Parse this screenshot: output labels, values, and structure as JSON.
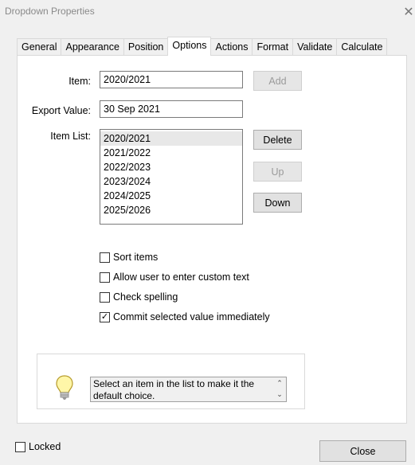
{
  "window": {
    "title": "Dropdown Properties"
  },
  "tabs": [
    {
      "label": "General"
    },
    {
      "label": "Appearance"
    },
    {
      "label": "Position"
    },
    {
      "label": "Options",
      "active": true
    },
    {
      "label": "Actions"
    },
    {
      "label": "Format"
    },
    {
      "label": "Validate"
    },
    {
      "label": "Calculate"
    }
  ],
  "options": {
    "item_label": "Item:",
    "item_value": "2020/2021",
    "export_label": "Export Value:",
    "export_value": "30 Sep 2021",
    "add_label": "Add",
    "item_list_label": "Item List:",
    "item_list": [
      "2020/2021",
      "2021/2022",
      "2022/2023",
      "2023/2024",
      "2024/2025",
      "2025/2026"
    ],
    "delete_label": "Delete",
    "up_label": "Up",
    "down_label": "Down",
    "checkboxes": [
      {
        "label": "Sort items",
        "checked": false
      },
      {
        "label": "Allow user to enter custom text",
        "checked": false
      },
      {
        "label": "Check spelling",
        "checked": false
      },
      {
        "label": "Commit selected value immediately",
        "checked": true
      }
    ],
    "hint": "Select an item in the list to make it the default choice."
  },
  "footer": {
    "locked_label": "Locked",
    "locked_checked": false,
    "close_label": "Close"
  },
  "icons": {
    "check_glyph": "✓",
    "close_glyph": "✕",
    "up_arrow_glyph": "⌃",
    "down_arrow_glyph": "⌄"
  }
}
